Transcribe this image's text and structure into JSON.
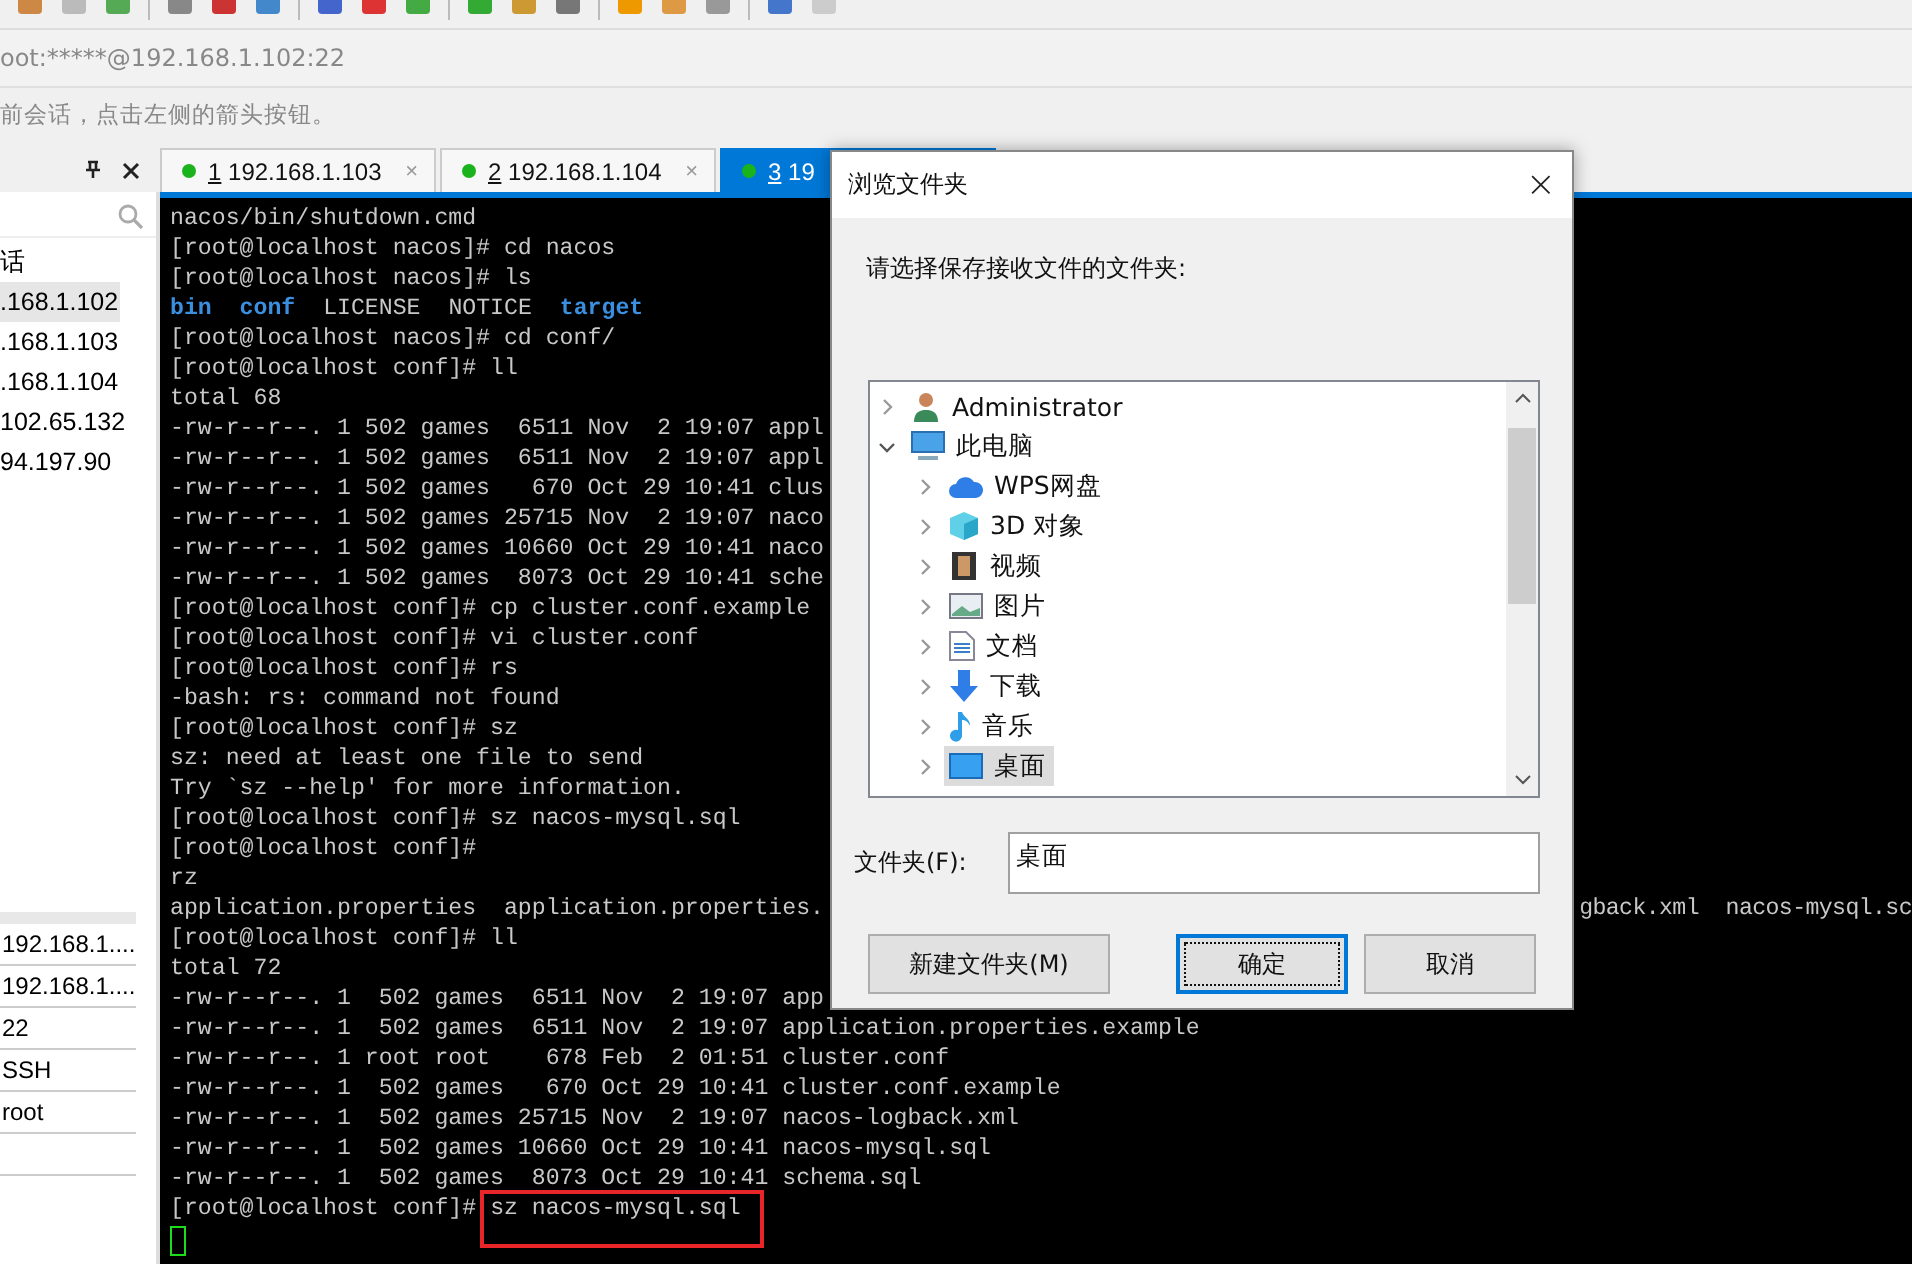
{
  "address_bar": {
    "text": "oot:*****@192.168.1.102:22"
  },
  "info_bar": {
    "text": "前会话，点击左侧的箭头按钮。"
  },
  "tabs": [
    {
      "number": "1",
      "label": "192.168.1.103",
      "selected": false,
      "close": "×"
    },
    {
      "number": "2",
      "label": "192.168.1.104",
      "selected": false,
      "close": "×"
    },
    {
      "number": "3",
      "label": "19",
      "selected": true
    }
  ],
  "sidebar": {
    "items": [
      {
        "label": "话",
        "selected": false
      },
      {
        "label": ".168.1.102",
        "selected": true
      },
      {
        "label": ".168.1.103",
        "selected": false
      },
      {
        "label": ".168.1.104",
        "selected": false
      },
      {
        "label": "102.65.132",
        "selected": false
      },
      {
        "label": "94.197.90",
        "selected": false
      }
    ],
    "properties": [
      "192.168.1....",
      "192.168.1....",
      "22",
      "SSH",
      "root"
    ]
  },
  "terminal": {
    "lines": [
      {
        "kind": "text",
        "text": "nacos/bin/shutdown.cmd"
      },
      {
        "kind": "text",
        "text": "[root@localhost nacos]# cd nacos"
      },
      {
        "kind": "text",
        "text": "[root@localhost nacos]# ls"
      },
      {
        "kind": "listing",
        "parts": [
          {
            "kind": "dir",
            "text": "bin"
          },
          {
            "kind": "dir",
            "text": "conf"
          },
          {
            "kind": "file",
            "text": "LICENSE"
          },
          {
            "kind": "file",
            "text": "NOTICE"
          },
          {
            "kind": "dir",
            "text": "target"
          }
        ]
      },
      {
        "kind": "text",
        "text": "[root@localhost nacos]# cd conf/"
      },
      {
        "kind": "text",
        "text": "[root@localhost conf]# ll"
      },
      {
        "kind": "text",
        "text": "total 68"
      },
      {
        "kind": "text",
        "text": "-rw-r--r--. 1 502 games  6511 Nov  2 19:07 appl"
      },
      {
        "kind": "text",
        "text": "-rw-r--r--. 1 502 games  6511 Nov  2 19:07 appl"
      },
      {
        "kind": "text",
        "text": "-rw-r--r--. 1 502 games   670 Oct 29 10:41 clus"
      },
      {
        "kind": "text",
        "text": "-rw-r--r--. 1 502 games 25715 Nov  2 19:07 naco"
      },
      {
        "kind": "text",
        "text": "-rw-r--r--. 1 502 games 10660 Oct 29 10:41 naco"
      },
      {
        "kind": "text",
        "text": "-rw-r--r--. 1 502 games  8073 Oct 29 10:41 sche"
      },
      {
        "kind": "text",
        "text": "[root@localhost conf]# cp cluster.conf.example"
      },
      {
        "kind": "text",
        "text": "[root@localhost conf]# vi cluster.conf"
      },
      {
        "kind": "text",
        "text": "[root@localhost conf]# rs"
      },
      {
        "kind": "text",
        "text": "-bash: rs: command not found"
      },
      {
        "kind": "text",
        "text": "[root@localhost conf]# sz"
      },
      {
        "kind": "text",
        "text": "sz: need at least one file to send"
      },
      {
        "kind": "text",
        "text": "Try `sz --help' for more information."
      },
      {
        "kind": "text",
        "text": "[root@localhost conf]# sz nacos-mysql.sql"
      },
      {
        "kind": "text",
        "text": "[root@localhost conf]#"
      },
      {
        "kind": "text",
        "text": "rz"
      },
      {
        "kind": "split",
        "parts": [
          "application.properties  application.properties.",
          "gback.xml  nacos-mysql.sc"
        ]
      },
      {
        "kind": "text",
        "text": "[root@localhost conf]# ll"
      },
      {
        "kind": "text",
        "text": "total 72"
      },
      {
        "kind": "text",
        "text": "-rw-r--r--. 1  502 games  6511 Nov  2 19:07 app"
      },
      {
        "kind": "text",
        "text": "-rw-r--r--. 1  502 games  6511 Nov  2 19:07 application.properties.example"
      },
      {
        "kind": "text",
        "text": "-rw-r--r--. 1 root root    678 Feb  2 01:51 cluster.conf"
      },
      {
        "kind": "text",
        "text": "-rw-r--r--. 1  502 games   670 Oct 29 10:41 cluster.conf.example"
      },
      {
        "kind": "text",
        "text": "-rw-r--r--. 1  502 games 25715 Nov  2 19:07 nacos-logback.xml"
      },
      {
        "kind": "text",
        "text": "-rw-r--r--. 1  502 games 10660 Oct 29 10:41 nacos-mysql.sql"
      },
      {
        "kind": "text",
        "text": "-rw-r--r--. 1  502 games  8073 Oct 29 10:41 schema.sql"
      },
      {
        "kind": "boxed",
        "prompt": "[root@localhost conf]#",
        "command": "sz nacos-mysql.sql"
      },
      {
        "kind": "cursor"
      }
    ]
  },
  "dialog": {
    "title": "浏览文件夹",
    "close": "×",
    "prompt": "请选择保存接收文件的文件夹:",
    "tree": [
      {
        "kind": "user",
        "label": "Administrator",
        "expanded": false,
        "selected": false
      },
      {
        "kind": "computer",
        "label": "此电脑",
        "expanded": true,
        "selected": false,
        "children": [
          {
            "kind": "cloud",
            "label": "WPS网盘",
            "expanded": false,
            "selected": false
          },
          {
            "kind": "cube",
            "label": "3D 对象",
            "expanded": false,
            "selected": false
          },
          {
            "kind": "video",
            "label": "视频",
            "expanded": false,
            "selected": false
          },
          {
            "kind": "image",
            "label": "图片",
            "expanded": false,
            "selected": false
          },
          {
            "kind": "document",
            "label": "文档",
            "expanded": false,
            "selected": false
          },
          {
            "kind": "download",
            "label": "下载",
            "expanded": false,
            "selected": false
          },
          {
            "kind": "music",
            "label": "音乐",
            "expanded": false,
            "selected": false
          },
          {
            "kind": "desktop",
            "label": "桌面",
            "expanded": false,
            "selected": true
          }
        ]
      }
    ],
    "folder_label": "文件夹(F):",
    "folder_value": "桌面",
    "buttons": [
      {
        "label": "新建文件夹(M)",
        "default": false
      },
      {
        "label": "确定",
        "default": true
      },
      {
        "label": "取消",
        "default": false
      }
    ]
  }
}
